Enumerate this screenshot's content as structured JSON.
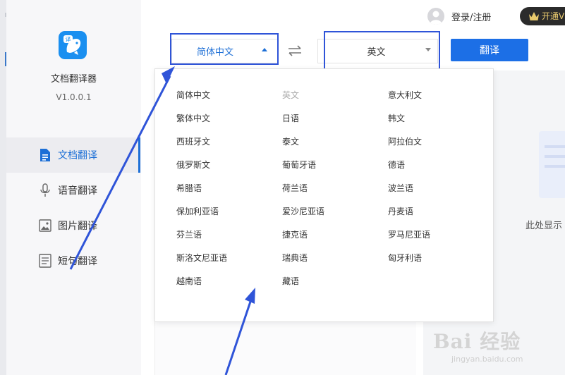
{
  "app": {
    "name": "文档翻译器",
    "version": "V1.0.0.1"
  },
  "sidebar": {
    "items": [
      {
        "label": "文档翻译",
        "icon": "document-icon",
        "active": true
      },
      {
        "label": "语音翻译",
        "icon": "microphone-icon"
      },
      {
        "label": "图片翻译",
        "icon": "image-icon"
      },
      {
        "label": "短句翻译",
        "icon": "text-icon"
      }
    ]
  },
  "header": {
    "login_label": "登录/注册",
    "vip_label": "开通V"
  },
  "toolbar": {
    "source_language": "简体中文",
    "target_language": "英文",
    "translate_label": "翻译"
  },
  "main": {
    "placeholder": "此处显示"
  },
  "dropdown": {
    "columns": [
      [
        "简体中文",
        "繁体中文",
        "西班牙文",
        "俄罗斯文",
        "希腊语",
        "保加利亚语",
        "芬兰语",
        "斯洛文尼亚语",
        "越南语"
      ],
      [
        "英文",
        "日语",
        "泰文",
        "葡萄牙语",
        "荷兰语",
        "爱沙尼亚语",
        "捷克语",
        "瑞典语",
        "藏语"
      ],
      [
        "意大利文",
        "韩文",
        "阿拉伯文",
        "德语",
        "波兰语",
        "丹麦语",
        "罗马尼亚语",
        "匈牙利语"
      ]
    ],
    "disabled": "英文"
  },
  "watermark": {
    "big": "Bai 经验",
    "small": "jingyan.baidu.com"
  },
  "colors": {
    "accent": "#1c6fe6",
    "annotation": "#2f54d8",
    "sidebar_bg": "#f7f7f9"
  }
}
